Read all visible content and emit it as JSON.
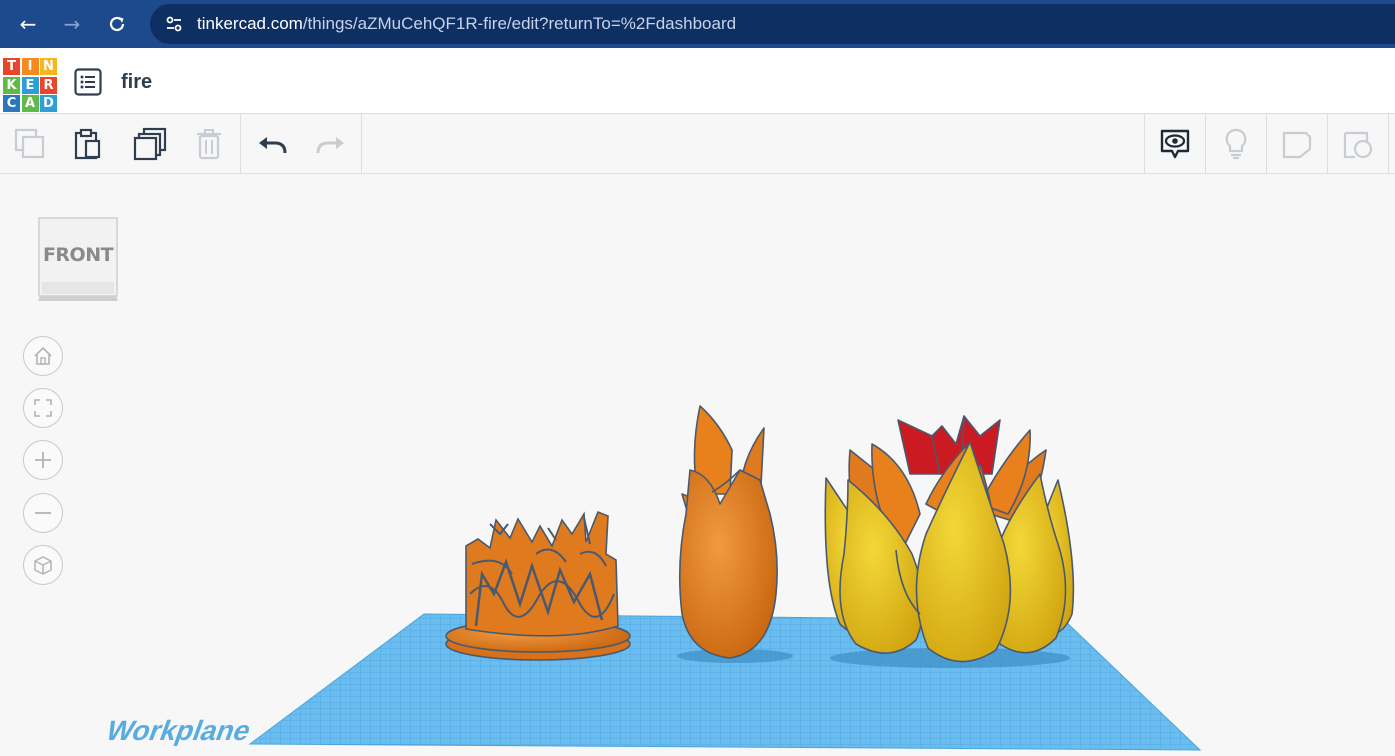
{
  "browser": {
    "url_host": "tinkercad.com",
    "url_path": "/things/aZMuCehQF1R-fire/edit?returnTo=%2Fdashboard",
    "back_icon": "arrow-left-icon",
    "forward_icon": "arrow-right-icon",
    "reload_icon": "reload-icon"
  },
  "app": {
    "logo_letters": [
      "T",
      "I",
      "N",
      "K",
      "E",
      "R",
      "C",
      "A",
      "D"
    ],
    "logo_colors": [
      "#e8452c",
      "#f48a20",
      "#f6b620",
      "#5dbb46",
      "#2a9fd8",
      "#e8452c",
      "#2a77c0",
      "#5dbb46",
      "#2a9fd8"
    ],
    "project_name": "fire"
  },
  "toolbar": {
    "left_tools": [
      "copy-icon",
      "paste-icon",
      "duplicate-icon",
      "delete-icon",
      "undo-icon",
      "redo-icon"
    ],
    "right_tools": [
      "view-toggle-icon",
      "bulb-icon",
      "note-icon",
      "ruler-icon"
    ]
  },
  "viewport": {
    "viewcube_label": "FRONT",
    "controls": [
      "home-view-icon",
      "fit-all-icon",
      "zoom-in-icon",
      "zoom-out-icon",
      "perspective-icon"
    ],
    "workplane_label": "Workplane",
    "colors": {
      "workplane": "#5fb6ea",
      "orange": "#e07a1e",
      "yellow": "#e6c11c",
      "red": "#cc1a22",
      "outline": "#4a5a6e"
    }
  }
}
